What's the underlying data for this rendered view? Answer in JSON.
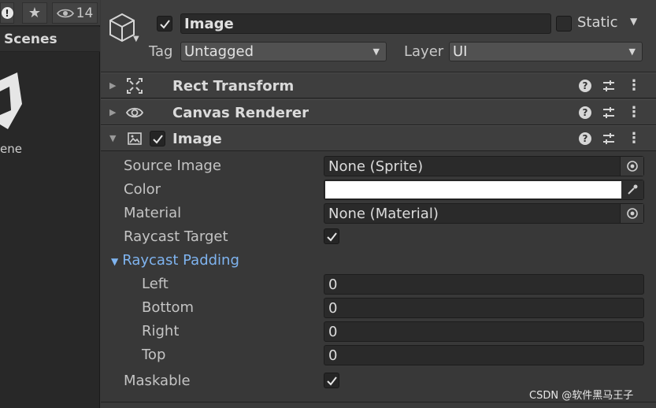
{
  "left_panel": {
    "eye_count": "14",
    "scenes_label": "Scenes",
    "scene_item": "ene"
  },
  "header": {
    "name": "Image",
    "static_label": "Static",
    "tag_label": "Tag",
    "tag_value": "Untagged",
    "layer_label": "Layer",
    "layer_value": "UI"
  },
  "components": [
    {
      "title": "Rect Transform"
    },
    {
      "title": "Canvas Renderer"
    },
    {
      "title": "Image"
    }
  ],
  "image_props": {
    "source_image_label": "Source Image",
    "source_image_value": "None (Sprite)",
    "color_label": "Color",
    "color_value": "#ffffff",
    "material_label": "Material",
    "material_value": "None (Material)",
    "raycast_target_label": "Raycast Target",
    "raycast_padding_label": "Raycast Padding",
    "left_label": "Left",
    "left_value": "0",
    "bottom_label": "Bottom",
    "bottom_value": "0",
    "right_label": "Right",
    "right_value": "0",
    "top_label": "Top",
    "top_value": "0",
    "maskable_label": "Maskable"
  },
  "watermark": "CSDN @软件黑马王子",
  "colors": {
    "accent_link": "#7fb4f0",
    "panel_bg": "#383838"
  }
}
